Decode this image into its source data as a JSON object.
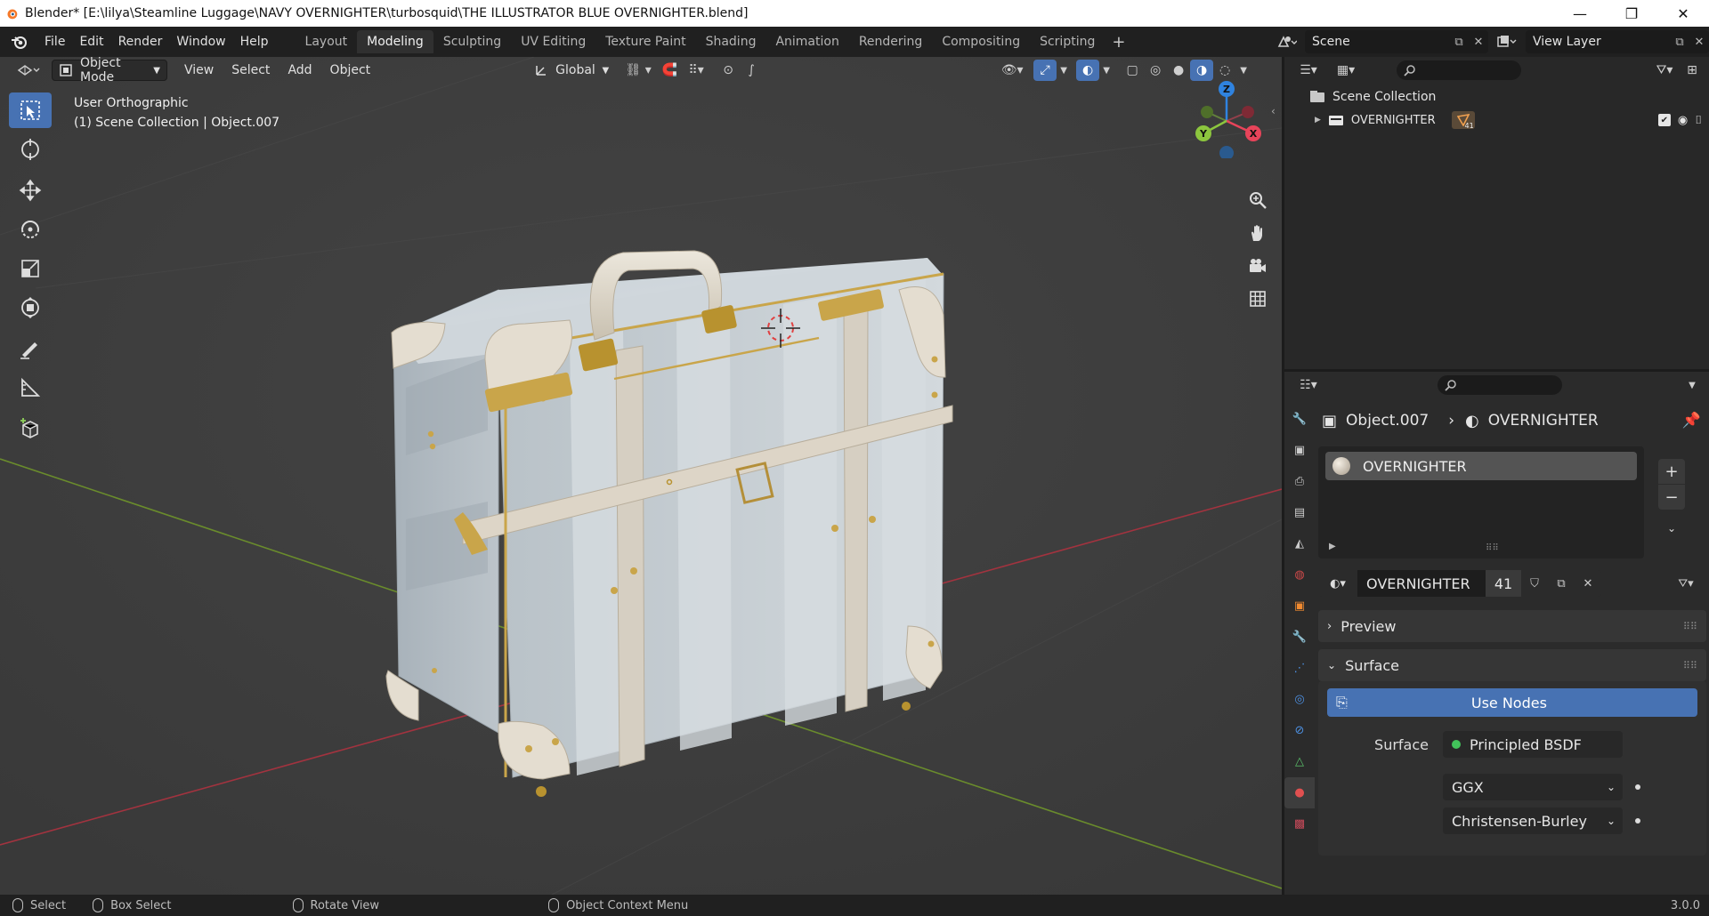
{
  "window": {
    "title": "Blender* [E:\\lilya\\Steamline Luggage\\NAVY OVERNIGHTER\\turbosquid\\THE ILLUSTRATOR BLUE OVERNIGHTER.blend]",
    "minimize": "—",
    "maximize": "❐",
    "close": "✕"
  },
  "menu": {
    "items": [
      "File",
      "Edit",
      "Render",
      "Window",
      "Help"
    ],
    "workspaces": [
      "Layout",
      "Modeling",
      "Sculpting",
      "UV Editing",
      "Texture Paint",
      "Shading",
      "Animation",
      "Rendering",
      "Compositing",
      "Scripting"
    ],
    "active_workspace": "Modeling",
    "add_workspace": "+",
    "scene": "Scene",
    "view_layer": "View Layer"
  },
  "viewport": {
    "mode": "Object Mode",
    "menus": [
      "View",
      "Select",
      "Add",
      "Object"
    ],
    "transform_orientation": "Global",
    "view_name": "User Orthographic",
    "collection_info": "(1) Scene Collection | Object.007",
    "gizmo": {
      "z": "Z",
      "y": "Y",
      "x": "X"
    }
  },
  "outliner": {
    "scene_collection": "Scene Collection",
    "collection": "OVERNIGHTER",
    "collection_badge": "41"
  },
  "properties": {
    "breadcrumb_object": "Object.007",
    "breadcrumb_material": "OVERNIGHTER",
    "material_slot": "OVERNIGHTER",
    "material_name": "OVERNIGHTER",
    "material_users": "41",
    "preview_label": "Preview",
    "surface_panel": "Surface",
    "use_nodes": "Use Nodes",
    "surface_label": "Surface",
    "surface_shader": "Principled BSDF",
    "distribution": "GGX",
    "subsurface_method": "Christensen-Burley"
  },
  "statusbar": {
    "select": "Select",
    "box_select": "Box Select",
    "rotate_view": "Rotate View",
    "context_menu": "Object Context Menu",
    "version": "3.0.0"
  },
  "colors": {
    "accent": "#4772b3",
    "x_axis": "#e8445a",
    "y_axis": "#8cc63e",
    "z_axis": "#2f83e0",
    "brass": "#c9a54a"
  }
}
